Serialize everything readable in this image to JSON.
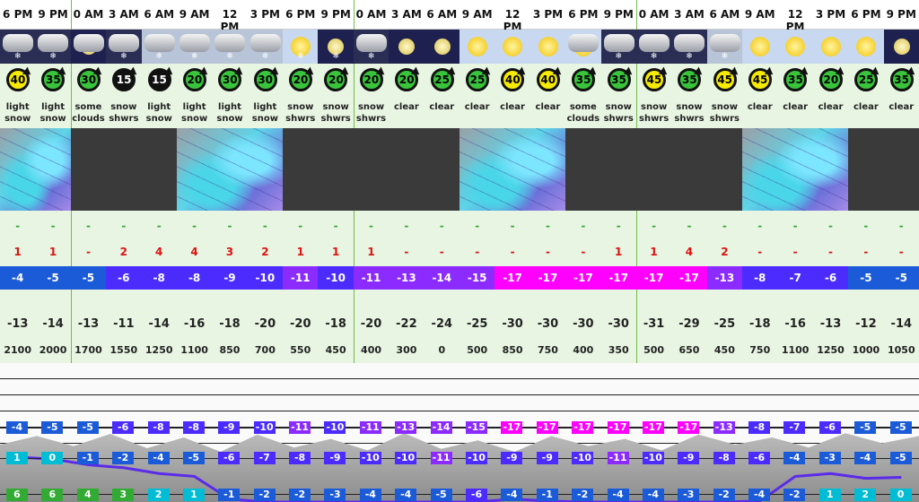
{
  "times": [
    "6 PM",
    "9 PM",
    "0 AM",
    "3 AM",
    "6 AM",
    "9 AM",
    "12 PM",
    "3 PM",
    "6 PM",
    "9 PM",
    "0 AM",
    "3 AM",
    "6 AM",
    "9 AM",
    "12 PM",
    "3 PM",
    "6 PM",
    "9 PM",
    "0 AM",
    "3 AM",
    "6 AM",
    "9 AM",
    "12 PM",
    "3 PM",
    "6 PM",
    "9 PM"
  ],
  "summaries": [
    "light snow",
    "light snow",
    "some clouds",
    "snow shwrs",
    "light snow",
    "light snow",
    "light snow",
    "light snow",
    "snow shwrs",
    "snow shwrs",
    "snow shwrs",
    "clear",
    "clear",
    "clear",
    "clear",
    "clear",
    "some clouds",
    "snow shwrs",
    "snow shwrs",
    "snow shwrs",
    "snow shwrs",
    "clear",
    "clear",
    "clear",
    "clear",
    "clear"
  ],
  "wind_speeds": [
    "40",
    "35",
    "30",
    "15",
    "15",
    "20",
    "30",
    "30",
    "20",
    "20",
    "20",
    "20",
    "25",
    "25",
    "40",
    "40",
    "35",
    "35",
    "45",
    "35",
    "45",
    "45",
    "35",
    "20",
    "25",
    "35"
  ],
  "snow_row": [
    "-",
    "-",
    "-",
    "-",
    "-",
    "-",
    "-",
    "-",
    "-",
    "-",
    "-",
    "-",
    "-",
    "-",
    "-",
    "-",
    "-",
    "-",
    "-",
    "-",
    "-",
    "-",
    "-",
    "-",
    "-",
    "-"
  ],
  "rain_row": [
    "1",
    "1",
    "-",
    "2",
    "4",
    "4",
    "3",
    "2",
    "1",
    "1",
    "1",
    "-",
    "-",
    "-",
    "-",
    "-",
    "-",
    "1",
    "1",
    "4",
    "2",
    "-",
    "-",
    "-",
    "-",
    "-"
  ],
  "max_temps": [
    "-4",
    "-5",
    "-5",
    "-6",
    "-8",
    "-8",
    "-9",
    "-10",
    "-11",
    "-10",
    "-11",
    "-13",
    "-14",
    "-15",
    "-17",
    "-17",
    "-17",
    "-17",
    "-17",
    "-17",
    "-13",
    "-8",
    "-7",
    "-6",
    "-5",
    "-5"
  ],
  "wind_chill": [
    "-13",
    "-14",
    "-13",
    "-11",
    "-14",
    "-16",
    "-18",
    "-20",
    "-20",
    "-18",
    "-20",
    "-22",
    "-24",
    "-25",
    "-30",
    "-30",
    "-30",
    "-30",
    "-31",
    "-29",
    "-25",
    "-18",
    "-16",
    "-13",
    "-12",
    "-14"
  ],
  "freezing_level": [
    "2100",
    "2000",
    "1700",
    "1550",
    "1250",
    "1100",
    "850",
    "700",
    "550",
    "450",
    "400",
    "300",
    "0",
    "500",
    "850",
    "750",
    "400",
    "350",
    "500",
    "650",
    "450",
    "750",
    "1100",
    "1250",
    "1000",
    "1050"
  ],
  "chart_top": [
    "-4",
    "-5",
    "-5",
    "-6",
    "-8",
    "-8",
    "-9",
    "-10",
    "-11",
    "-10",
    "-11",
    "-13",
    "-14",
    "-15",
    "-17",
    "-17",
    "-17",
    "-17",
    "-17",
    "-17",
    "-13",
    "-8",
    "-7",
    "-6",
    "-5",
    "-5"
  ],
  "chart_mid": [
    "1",
    "0",
    "-1",
    "-2",
    "-4",
    "-5",
    "-6",
    "-7",
    "-8",
    "-9",
    "-10",
    "-10",
    "-11",
    "-10",
    "-9",
    "-9",
    "-10",
    "-11",
    "-10",
    "-9",
    "-8",
    "-6",
    "-4",
    "-3",
    "-4",
    "-5"
  ],
  "chart_low": [
    "6",
    "6",
    "4",
    "3",
    "2",
    "1",
    "-1",
    "-2",
    "-2",
    "-3",
    "-4",
    "-4",
    "-5",
    "-6",
    "-4",
    "-1",
    "-2",
    "-4",
    "-4",
    "-3",
    "-2",
    "-4",
    "-2",
    "1",
    "2",
    "0"
  ],
  "colors": {
    "ok": "#1c5bd8",
    "cold": "#4b2bff",
    "very_cold": "#8b2bff",
    "extreme": "#ff00ff",
    "green": "#6fbf4a"
  }
}
